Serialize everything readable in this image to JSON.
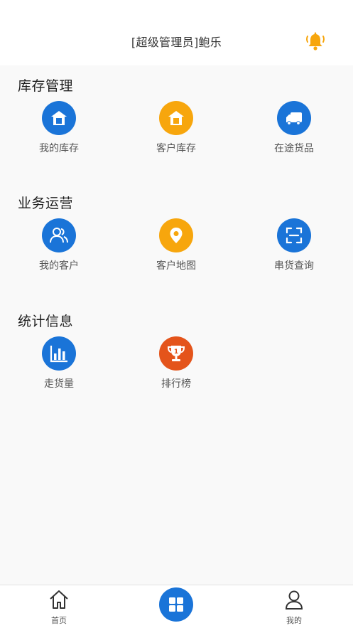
{
  "header": {
    "title": "[超级管理员]鲍乐",
    "bell_color": "#f7a60d"
  },
  "sections": [
    {
      "title": "库存管理",
      "items": [
        {
          "label": "我的库存",
          "icon": "home-box-icon",
          "color": "#1a74d8"
        },
        {
          "label": "客户库存",
          "icon": "home-box-icon",
          "color": "#f7a60d"
        },
        {
          "label": "在途货品",
          "icon": "truck-icon",
          "color": "#1a74d8"
        }
      ]
    },
    {
      "title": "业务运营",
      "items": [
        {
          "label": "我的客户",
          "icon": "users-icon",
          "color": "#1a74d8"
        },
        {
          "label": "客户地图",
          "icon": "map-pin-icon",
          "color": "#f7a60d"
        },
        {
          "label": "串货查询",
          "icon": "scan-icon",
          "color": "#1a74d8"
        }
      ]
    },
    {
      "title": "统计信息",
      "items": [
        {
          "label": "走货量",
          "icon": "bar-chart-icon",
          "color": "#1a74d8"
        },
        {
          "label": "排行榜",
          "icon": "trophy-icon",
          "color": "#e4541b"
        }
      ]
    }
  ],
  "tabbar": {
    "home_label": "首页",
    "mine_label": "我的",
    "center_icon": "grid-icon"
  }
}
